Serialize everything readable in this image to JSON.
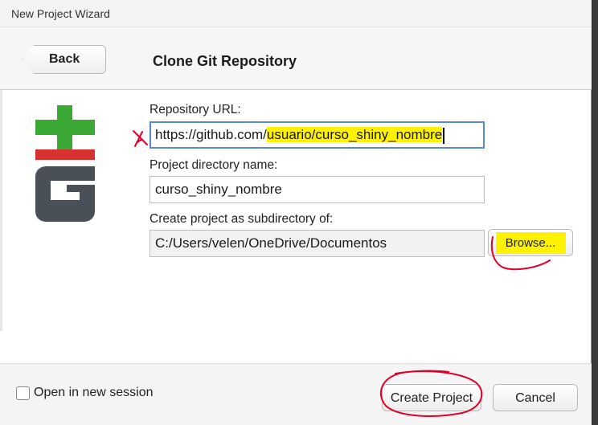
{
  "window": {
    "title": "New Project Wizard"
  },
  "header": {
    "back_label": "Back",
    "title": "Clone Git Repository"
  },
  "form": {
    "repo_url": {
      "label": "Repository URL:",
      "value_parts": [
        "https://github.com/",
        "usuario/",
        "curso_shiny",
        "_nombre"
      ]
    },
    "project_dir": {
      "label": "Project directory name:",
      "value": "curso_shiny_nombre"
    },
    "subdir": {
      "label": "Create project as subdirectory of:",
      "value": "C:/Users/velen/OneDrive/Documentos"
    },
    "browse_label": "Browse..."
  },
  "footer": {
    "open_new_session_label": "Open in new session",
    "open_new_session_checked": false,
    "create_label": "Create Project",
    "cancel_label": "Cancel"
  },
  "colors": {
    "highlight": "#fff200",
    "annotation_red": "#e0002a",
    "git_green": "#3aaa35",
    "git_red": "#d7322f",
    "git_gray": "#4a5058",
    "focus_border": "#5b88c9"
  }
}
